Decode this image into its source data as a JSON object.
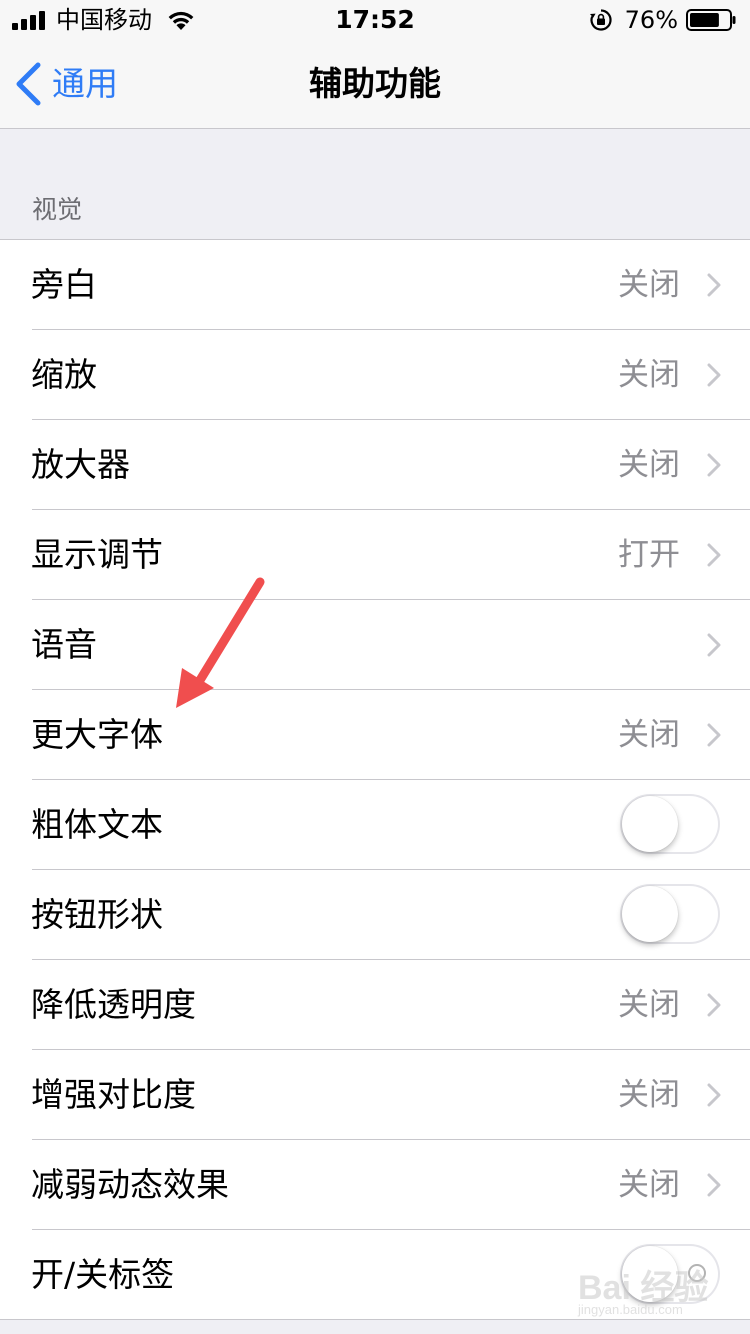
{
  "status_bar": {
    "carrier": "中国移动",
    "time": "17:52",
    "battery_percent": "76%",
    "battery_level": 0.76
  },
  "nav": {
    "back_label": "通用",
    "title": "辅助功能",
    "accent_color": "#2f7cf6"
  },
  "section": {
    "header": "视觉"
  },
  "rows": [
    {
      "label": "旁白",
      "value": "关闭",
      "type": "disclosure"
    },
    {
      "label": "缩放",
      "value": "关闭",
      "type": "disclosure"
    },
    {
      "label": "放大器",
      "value": "关闭",
      "type": "disclosure"
    },
    {
      "label": "显示调节",
      "value": "打开",
      "type": "disclosure"
    },
    {
      "label": "语音",
      "value": "",
      "type": "disclosure"
    },
    {
      "label": "更大字体",
      "value": "关闭",
      "type": "disclosure"
    },
    {
      "label": "粗体文本",
      "type": "toggle",
      "on": false
    },
    {
      "label": "按钮形状",
      "type": "toggle",
      "on": false
    },
    {
      "label": "降低透明度",
      "value": "关闭",
      "type": "disclosure"
    },
    {
      "label": "增强对比度",
      "value": "关闭",
      "type": "disclosure"
    },
    {
      "label": "减弱动态效果",
      "value": "关闭",
      "type": "disclosure"
    },
    {
      "label": "开/关标签",
      "type": "toggle",
      "on": false
    }
  ],
  "annotation": {
    "color": "#f04e4e",
    "icon": "red-arrow-icon"
  },
  "watermark": {
    "text": "Bai 经验",
    "sub": "jingyan.baidu.com"
  }
}
